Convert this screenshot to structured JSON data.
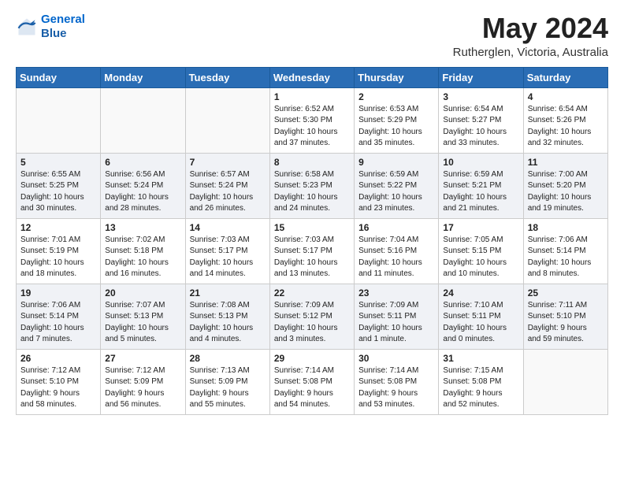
{
  "header": {
    "logo_line1": "General",
    "logo_line2": "Blue",
    "month_title": "May 2024",
    "location": "Rutherglen, Victoria, Australia"
  },
  "days_of_week": [
    "Sunday",
    "Monday",
    "Tuesday",
    "Wednesday",
    "Thursday",
    "Friday",
    "Saturday"
  ],
  "weeks": [
    [
      {
        "day": "",
        "info": ""
      },
      {
        "day": "",
        "info": ""
      },
      {
        "day": "",
        "info": ""
      },
      {
        "day": "1",
        "info": "Sunrise: 6:52 AM\nSunset: 5:30 PM\nDaylight: 10 hours\nand 37 minutes."
      },
      {
        "day": "2",
        "info": "Sunrise: 6:53 AM\nSunset: 5:29 PM\nDaylight: 10 hours\nand 35 minutes."
      },
      {
        "day": "3",
        "info": "Sunrise: 6:54 AM\nSunset: 5:27 PM\nDaylight: 10 hours\nand 33 minutes."
      },
      {
        "day": "4",
        "info": "Sunrise: 6:54 AM\nSunset: 5:26 PM\nDaylight: 10 hours\nand 32 minutes."
      }
    ],
    [
      {
        "day": "5",
        "info": "Sunrise: 6:55 AM\nSunset: 5:25 PM\nDaylight: 10 hours\nand 30 minutes."
      },
      {
        "day": "6",
        "info": "Sunrise: 6:56 AM\nSunset: 5:24 PM\nDaylight: 10 hours\nand 28 minutes."
      },
      {
        "day": "7",
        "info": "Sunrise: 6:57 AM\nSunset: 5:24 PM\nDaylight: 10 hours\nand 26 minutes."
      },
      {
        "day": "8",
        "info": "Sunrise: 6:58 AM\nSunset: 5:23 PM\nDaylight: 10 hours\nand 24 minutes."
      },
      {
        "day": "9",
        "info": "Sunrise: 6:59 AM\nSunset: 5:22 PM\nDaylight: 10 hours\nand 23 minutes."
      },
      {
        "day": "10",
        "info": "Sunrise: 6:59 AM\nSunset: 5:21 PM\nDaylight: 10 hours\nand 21 minutes."
      },
      {
        "day": "11",
        "info": "Sunrise: 7:00 AM\nSunset: 5:20 PM\nDaylight: 10 hours\nand 19 minutes."
      }
    ],
    [
      {
        "day": "12",
        "info": "Sunrise: 7:01 AM\nSunset: 5:19 PM\nDaylight: 10 hours\nand 18 minutes."
      },
      {
        "day": "13",
        "info": "Sunrise: 7:02 AM\nSunset: 5:18 PM\nDaylight: 10 hours\nand 16 minutes."
      },
      {
        "day": "14",
        "info": "Sunrise: 7:03 AM\nSunset: 5:17 PM\nDaylight: 10 hours\nand 14 minutes."
      },
      {
        "day": "15",
        "info": "Sunrise: 7:03 AM\nSunset: 5:17 PM\nDaylight: 10 hours\nand 13 minutes."
      },
      {
        "day": "16",
        "info": "Sunrise: 7:04 AM\nSunset: 5:16 PM\nDaylight: 10 hours\nand 11 minutes."
      },
      {
        "day": "17",
        "info": "Sunrise: 7:05 AM\nSunset: 5:15 PM\nDaylight: 10 hours\nand 10 minutes."
      },
      {
        "day": "18",
        "info": "Sunrise: 7:06 AM\nSunset: 5:14 PM\nDaylight: 10 hours\nand 8 minutes."
      }
    ],
    [
      {
        "day": "19",
        "info": "Sunrise: 7:06 AM\nSunset: 5:14 PM\nDaylight: 10 hours\nand 7 minutes."
      },
      {
        "day": "20",
        "info": "Sunrise: 7:07 AM\nSunset: 5:13 PM\nDaylight: 10 hours\nand 5 minutes."
      },
      {
        "day": "21",
        "info": "Sunrise: 7:08 AM\nSunset: 5:13 PM\nDaylight: 10 hours\nand 4 minutes."
      },
      {
        "day": "22",
        "info": "Sunrise: 7:09 AM\nSunset: 5:12 PM\nDaylight: 10 hours\nand 3 minutes."
      },
      {
        "day": "23",
        "info": "Sunrise: 7:09 AM\nSunset: 5:11 PM\nDaylight: 10 hours\nand 1 minute."
      },
      {
        "day": "24",
        "info": "Sunrise: 7:10 AM\nSunset: 5:11 PM\nDaylight: 10 hours\nand 0 minutes."
      },
      {
        "day": "25",
        "info": "Sunrise: 7:11 AM\nSunset: 5:10 PM\nDaylight: 9 hours\nand 59 minutes."
      }
    ],
    [
      {
        "day": "26",
        "info": "Sunrise: 7:12 AM\nSunset: 5:10 PM\nDaylight: 9 hours\nand 58 minutes."
      },
      {
        "day": "27",
        "info": "Sunrise: 7:12 AM\nSunset: 5:09 PM\nDaylight: 9 hours\nand 56 minutes."
      },
      {
        "day": "28",
        "info": "Sunrise: 7:13 AM\nSunset: 5:09 PM\nDaylight: 9 hours\nand 55 minutes."
      },
      {
        "day": "29",
        "info": "Sunrise: 7:14 AM\nSunset: 5:08 PM\nDaylight: 9 hours\nand 54 minutes."
      },
      {
        "day": "30",
        "info": "Sunrise: 7:14 AM\nSunset: 5:08 PM\nDaylight: 9 hours\nand 53 minutes."
      },
      {
        "day": "31",
        "info": "Sunrise: 7:15 AM\nSunset: 5:08 PM\nDaylight: 9 hours\nand 52 minutes."
      },
      {
        "day": "",
        "info": ""
      }
    ]
  ]
}
